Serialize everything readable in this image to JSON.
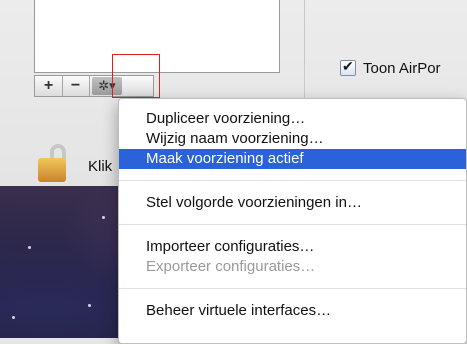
{
  "pane": {
    "add_label": "+",
    "remove_label": "−",
    "gear_label": "✲▾",
    "checkbox_label": "Toon AirPor",
    "lock_text": "Klik"
  },
  "menu": {
    "items": [
      "Dupliceer voorziening…",
      "Wijzig naam voorziening…",
      "Maak voorziening actief",
      "Stel volgorde voorzieningen in…",
      "Importeer configuraties…",
      "Exporteer configuraties…",
      "Beheer virtuele interfaces…"
    ]
  }
}
